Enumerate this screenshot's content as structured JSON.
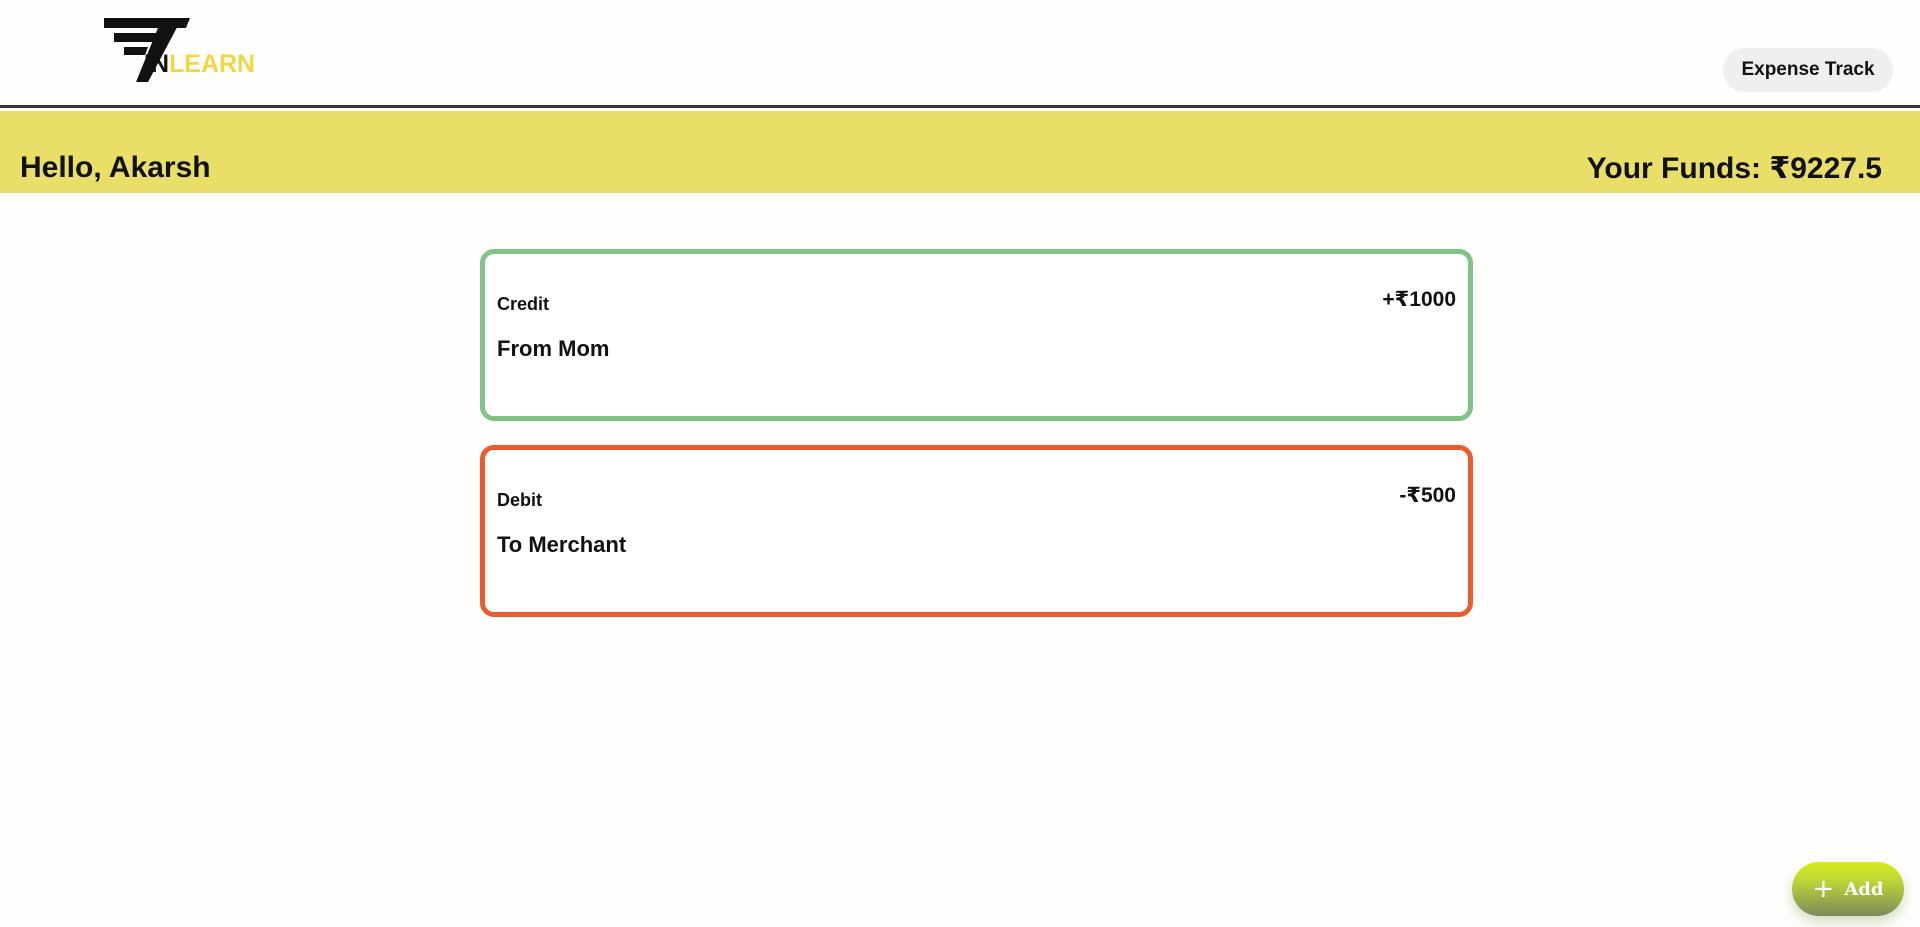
{
  "header": {
    "logo": {
      "prefix": "IN",
      "suffix": "LEARN",
      "accent_color": "#f1d646"
    },
    "nav_button_label": "Expense Track"
  },
  "banner": {
    "greeting": "Hello, Akarsh",
    "funds": "Your Funds: ₹9227.5",
    "background_color": "#e9df68"
  },
  "transactions": [
    {
      "type": "Credit",
      "description": "From Mom",
      "amount": "+₹1000",
      "border_color": "#7fc387"
    },
    {
      "type": "Debit",
      "description": "To Merchant",
      "amount": "-₹500",
      "border_color": "#e85c2e"
    }
  ],
  "fab": {
    "icon": "plus-icon",
    "label": "Add"
  }
}
